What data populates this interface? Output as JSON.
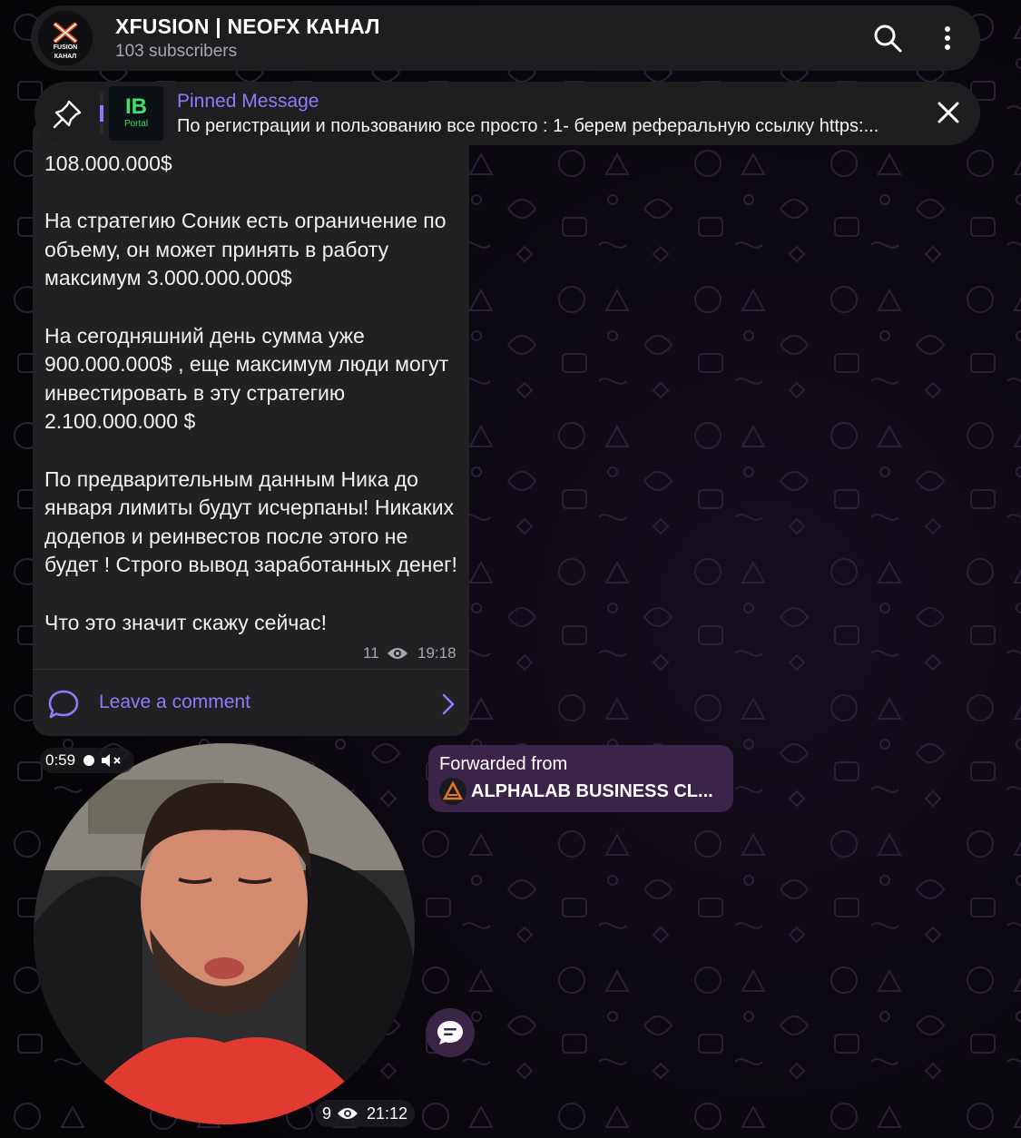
{
  "header": {
    "title": "XFUSION | NEOFX КАНАЛ",
    "subscribers": "103 subscribers",
    "avatar_logo_text": "X FUSION КАНАЛ",
    "search_icon": "search-icon",
    "menu_icon": "more-vertical-icon"
  },
  "pinned": {
    "title": "Pinned Message",
    "text": "По регистрации и пользованию все просто : 1- берем реферальную ссылку https:...",
    "thumb_logo_text": "IB Portal",
    "pin_icon": "pin-icon",
    "close_icon": "close-icon"
  },
  "message": {
    "text": "108.000.000$\n\nНа стратегию Соник есть ограничение по объему, он может принять в работу максимум 3.000.000.000$\n\nНа сегодняшний день сумма уже 900.000.000$ , еще максимум люди могут инвестировать в эту стратегию 2.100.000.000 $\n\nПо предварительным данным Ника до января лимиты будут исчерпаны! Никаких додепов и реинвестов после этого не будет ! Строго вывод заработанных денег!\n\nЧто это значит скажу сейчас!",
    "views": "11",
    "time": "19:18",
    "comment_label": "Leave a comment"
  },
  "video": {
    "duration": "0:59",
    "views": "9",
    "time": "21:12"
  },
  "forwarded": {
    "label": "Forwarded from",
    "source": "ALPHALAB BUSINESS CL..."
  },
  "colors": {
    "accent": "#8f7bf7",
    "panel": "#1e1e21",
    "bubble": "#212124",
    "forward_bg": "#3a2449"
  }
}
